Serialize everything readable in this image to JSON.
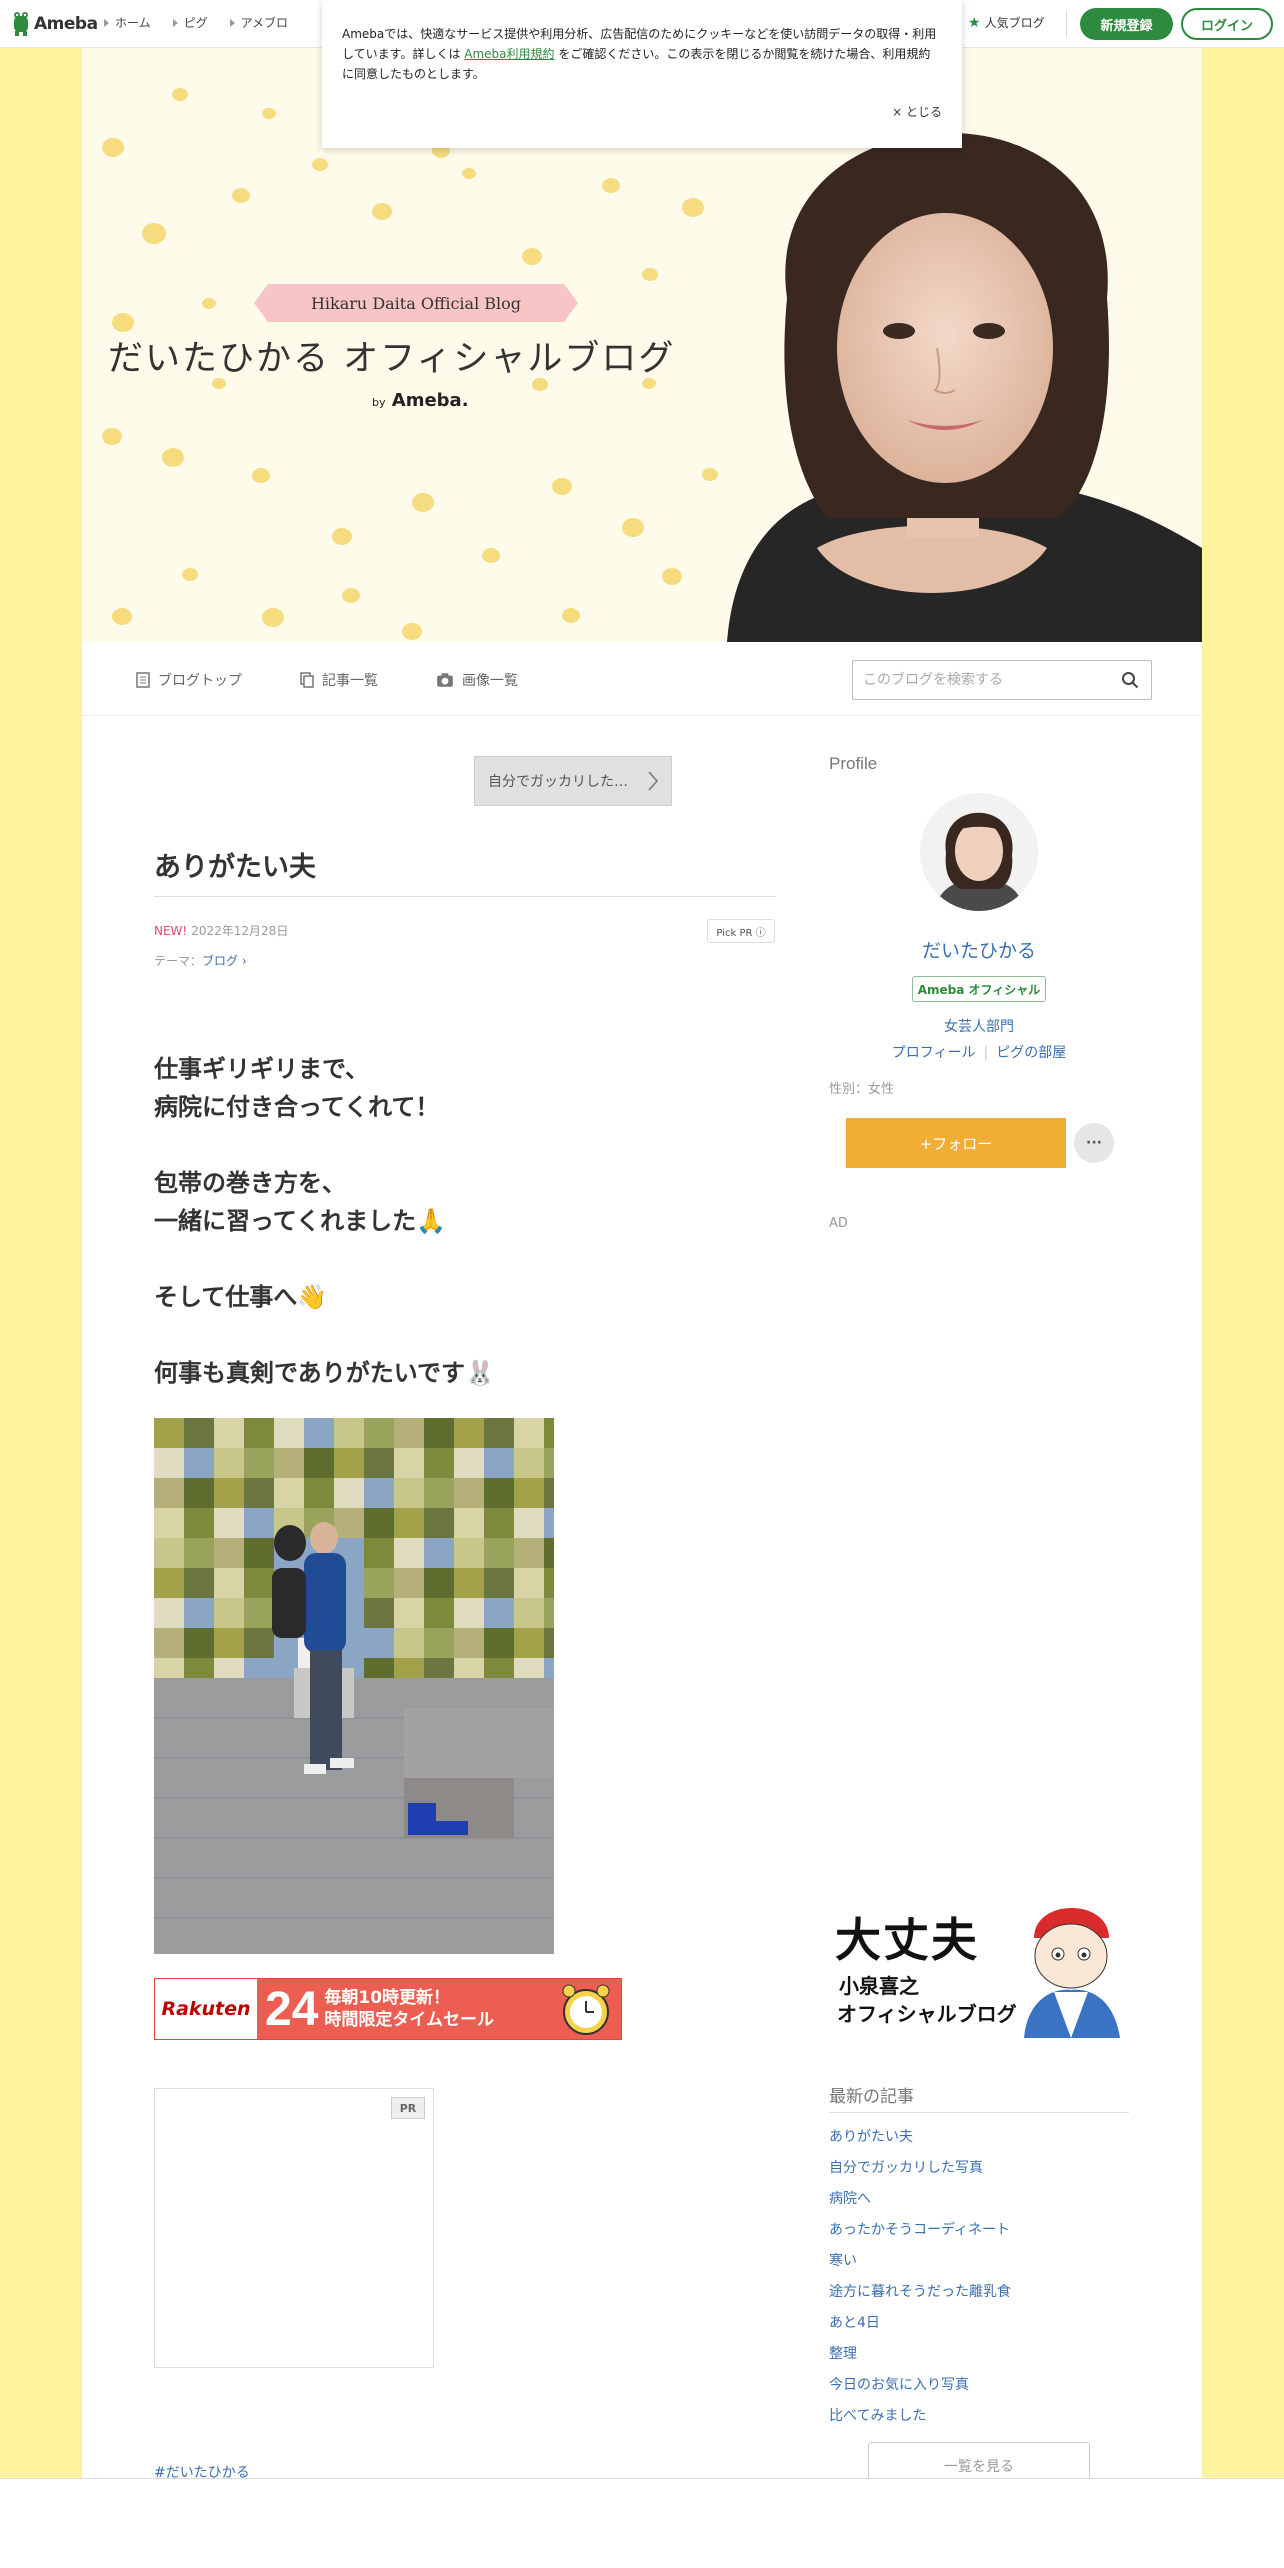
{
  "topbar": {
    "logo_text": "Ameba",
    "nav": [
      "ホーム",
      "ピグ",
      "アメブロ"
    ],
    "popular": "人気ブログ",
    "signup": "新規登録",
    "login": "ログイン",
    "brand_color": "#2d8a3e"
  },
  "cookie": {
    "text_before": "Amebaでは、快適なサービス提供や利用分析、広告配信のためにクッキーなどを使い訪問データの取得・利用しています。詳しくは ",
    "link": "Ameba利用規約",
    "text_after": " をご確認ください。この表示を閉じるか閲覧を続けた場合、利用規約に同意したものとします。",
    "close": "× とじる"
  },
  "header": {
    "ribbon": "Hikaru Daita Official Blog",
    "title": "だいたひかる オフィシャルブログ",
    "by": "by",
    "by_brand": "Ameba."
  },
  "blognav": {
    "top": "ブログトップ",
    "list": "記事一覧",
    "images": "画像一覧",
    "search_placeholder": "このブログを検索する"
  },
  "entry": {
    "prev_label": "自分でガッカリした…",
    "title": "ありがたい夫",
    "new_badge": "NEW!",
    "date": "2022年12月28日",
    "pick_pr": "Pick PR ⓘ",
    "theme_label": "テーマ：",
    "theme": "ブログ",
    "lines": [
      "仕事ギリギリまで、",
      "病院に付き合ってくれて！",
      "",
      "包帯の巻き方を、",
      "一緒に習ってくれました🙏",
      "",
      "そして仕事へ👋",
      "",
      "何事も真剣でありがたいです🐰"
    ],
    "rakuten_logo": "Rakuten",
    "rakuten_num": "24",
    "rakuten_line1": "毎朝10時更新！",
    "rakuten_line2": "時間限定タイムセール",
    "pr_badge": "PR",
    "hashtag": "#だいたひかる"
  },
  "sidebar": {
    "profile_heading": "Profile",
    "name": "だいたひかる",
    "official": "Ameba オフィシャル",
    "genre": "女芸人部門",
    "profile_link": "プロフィール",
    "pig_link": "ピグの部屋",
    "gender": "性別：女性",
    "follow": "+フォロー",
    "more": "···",
    "ad": "AD",
    "banner_title": "大丈夫",
    "banner_name": "小泉喜之",
    "banner_sub": "オフィシャルブログ",
    "recent_heading": "最新の記事",
    "recent": [
      "ありがたい夫",
      "自分でガッカリした写真",
      "病院へ",
      "あったかそうコーディネート",
      "寒い",
      "途方に暮れそうだった離乳食",
      "あと4日",
      "整理",
      "今日のお気に入り写真",
      "比べてみました"
    ],
    "see_all": "一覧を見る",
    "link_color": "#3a6fb0",
    "follow_color": "#f0ae34"
  }
}
